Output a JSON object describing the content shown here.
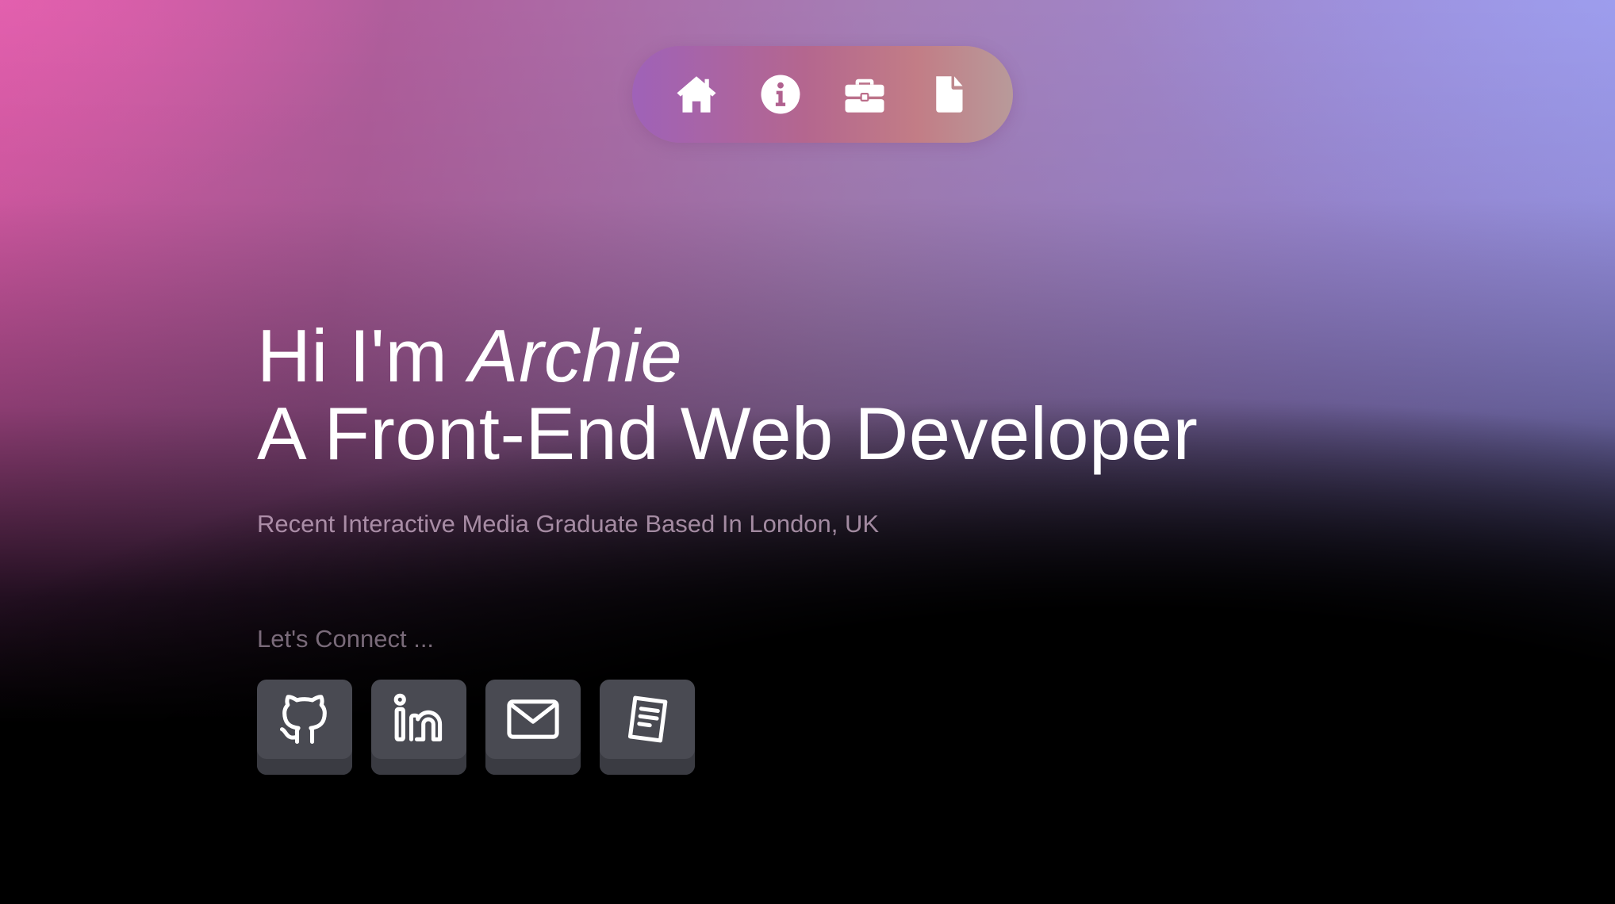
{
  "nav": {
    "items": [
      {
        "icon": "home-icon",
        "name": "nav-home"
      },
      {
        "icon": "info-icon",
        "name": "nav-about"
      },
      {
        "icon": "briefcase-icon",
        "name": "nav-work"
      },
      {
        "icon": "file-icon",
        "name": "nav-cv"
      }
    ]
  },
  "hero": {
    "greeting": "Hi I'm ",
    "name": "Archie",
    "role": "A Front-End Web Developer",
    "subtitle": "Recent Interactive Media Graduate Based In London, UK"
  },
  "connect": {
    "label": "Let's Connect ...",
    "links": [
      {
        "icon": "github-icon"
      },
      {
        "icon": "linkedin-icon"
      },
      {
        "icon": "mail-icon"
      },
      {
        "icon": "document-icon"
      }
    ]
  },
  "colors": {
    "gradient_left": "#d95aa6",
    "gradient_right": "#9a98ec",
    "button_bg": "#494a52"
  }
}
